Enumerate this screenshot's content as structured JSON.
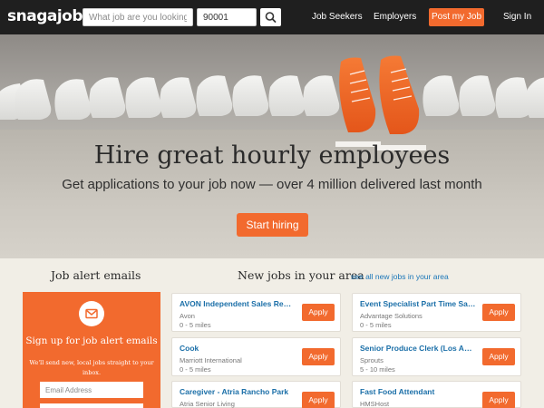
{
  "brand": {
    "logo": "snagajob",
    "accent": "#f26a2e",
    "nav_bg": "#1f1f1f",
    "link_color": "#1a76b8"
  },
  "search": {
    "what_placeholder": "What job are you looking for",
    "where_value": "90001",
    "button_icon": "search-icon"
  },
  "nav": {
    "job_seekers": "Job Seekers",
    "employers": "Employers",
    "post_job": "Post my Job",
    "sign_in": "Sign In"
  },
  "hero": {
    "title": "Hire great hourly employees",
    "subtitle": "Get applications to your job now — over 4 million delivered last month",
    "cta": "Start hiring"
  },
  "alerts": {
    "heading": "Job alert emails",
    "card_title": "Sign up for job alert emails",
    "card_desc": "We'll send new, local jobs straight to your inbox.",
    "email_placeholder": "Email Address",
    "icon": "mail-icon"
  },
  "jobs": {
    "heading": "New jobs in your area",
    "see_all": "see all new jobs in your area",
    "apply_label": "Apply",
    "items": [
      {
        "title": "AVON Independent Sales Repr...",
        "company": "Avon",
        "distance": "0 - 5 miles"
      },
      {
        "title": "Event Specialist Part Time Sal...",
        "company": "Advantage Solutions",
        "distance": "0 - 5 miles"
      },
      {
        "title": "Cook",
        "company": "Marriott International",
        "distance": "0 - 5 miles"
      },
      {
        "title": "Senior Produce Clerk (Los Ang...",
        "company": "Sprouts",
        "distance": "5 - 10 miles"
      },
      {
        "title": "Caregiver - Atria Rancho Park",
        "company": "Atria Senior Living",
        "distance": ""
      },
      {
        "title": "Fast Food Attendant",
        "company": "HMSHost",
        "distance": ""
      }
    ]
  }
}
